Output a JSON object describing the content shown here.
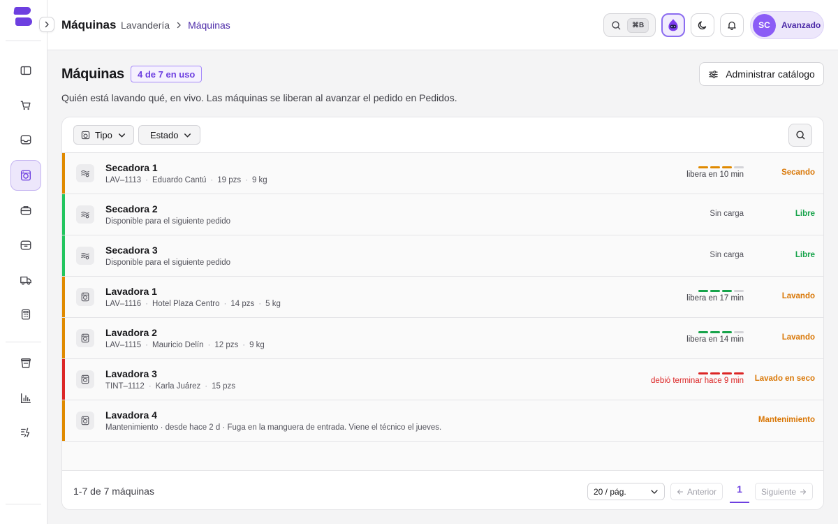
{
  "app": {
    "logo": "brand-logo"
  },
  "sidebar": {
    "items": [
      {
        "icon": "sidebar-layout-icon",
        "name": "sidebar-item-layout"
      },
      {
        "icon": "cart-icon",
        "name": "sidebar-item-cart"
      },
      {
        "icon": "inbox-icon",
        "name": "sidebar-item-inbox"
      },
      {
        "icon": "washing-machine-icon",
        "name": "sidebar-item-machines",
        "active": true
      },
      {
        "icon": "briefcase-icon",
        "name": "sidebar-item-briefcase"
      },
      {
        "icon": "archive-icon",
        "name": "sidebar-item-archive"
      },
      {
        "icon": "truck-icon",
        "name": "sidebar-item-delivery"
      },
      {
        "icon": "calculator-icon",
        "name": "sidebar-item-calculator"
      },
      {
        "icon": "bucket-icon",
        "name": "sidebar-item-supplies"
      },
      {
        "icon": "chart-icon",
        "name": "sidebar-item-reports"
      },
      {
        "icon": "sparkle-list-icon",
        "name": "sidebar-item-automation"
      }
    ]
  },
  "topbar": {
    "title": "Máquinas",
    "breadcrumb": [
      "Lavandería",
      "Máquinas"
    ],
    "search_shortcut": "⌘B",
    "user_initials": "SC",
    "user_level": "Avanzado"
  },
  "page": {
    "title": "Máquinas",
    "usage_badge": "4 de 7 en uso",
    "catalog_button": "Administrar catálogo",
    "subtitle": "Quién está lavando qué, en vivo. Las máquinas se liberan al avanzar el pedido en Pedidos."
  },
  "filters": {
    "type": "Tipo",
    "status": "Estado"
  },
  "colors": {
    "accent": "#6d3fe0",
    "orange": "#e08a00",
    "green": "#16a34a",
    "red": "#dc2626",
    "grey": "#d4d4d8"
  },
  "machines": [
    {
      "name": "Secadora 1",
      "kind": "dryer",
      "meta": [
        "LAV‒1113",
        "Eduardo Cantú",
        "19 pzs",
        "9 kg"
      ],
      "eta": "libera en 10 min",
      "progress": [
        1,
        1,
        1,
        0
      ],
      "progress_color": "#e08a00",
      "status": "Secando",
      "status_color": "#d97706",
      "stripe": "#e08a00"
    },
    {
      "name": "Secadora 2",
      "kind": "dryer",
      "meta": [
        "Disponible para el siguiente pedido"
      ],
      "eta": "Sin carga",
      "progress": [],
      "status": "Libre",
      "status_color": "#16a34a",
      "stripe": "#22c55e"
    },
    {
      "name": "Secadora 3",
      "kind": "dryer",
      "meta": [
        "Disponible para el siguiente pedido"
      ],
      "eta": "Sin carga",
      "progress": [],
      "status": "Libre",
      "status_color": "#16a34a",
      "stripe": "#22c55e"
    },
    {
      "name": "Lavadora 1",
      "kind": "washer",
      "meta": [
        "LAV‒1116",
        "Hotel Plaza Centro",
        "14 pzs",
        "5 kg"
      ],
      "eta": "libera en 17 min",
      "progress": [
        1,
        1,
        1,
        0
      ],
      "progress_color": "#16a34a",
      "status": "Lavando",
      "status_color": "#d97706",
      "stripe": "#e08a00"
    },
    {
      "name": "Lavadora 2",
      "kind": "washer",
      "meta": [
        "LAV‒1115",
        "Mauricio Delín",
        "12 pzs",
        "9 kg"
      ],
      "eta": "libera en 14 min",
      "progress": [
        1,
        1,
        1,
        0
      ],
      "progress_color": "#16a34a",
      "status": "Lavando",
      "status_color": "#d97706",
      "stripe": "#e08a00"
    },
    {
      "name": "Lavadora 3",
      "kind": "washer",
      "meta": [
        "TINT‒1112",
        "Karla Juárez",
        "15 pzs"
      ],
      "eta": "debió terminar hace 9 min",
      "late": true,
      "progress": [
        1,
        1,
        1,
        1
      ],
      "progress_color": "#dc2626",
      "status": "Lavado en seco",
      "status_color": "#d97706",
      "stripe": "#dc2626"
    },
    {
      "name": "Lavadora 4",
      "kind": "washer",
      "meta": [
        "Mantenimiento · desde hace 2 d · Fuga en la manguera de entrada. Viene el técnico el jueves."
      ],
      "eta": "",
      "progress": [],
      "status": "Mantenimiento",
      "status_color": "#d97706",
      "stripe": "#e08a00"
    }
  ],
  "footer": {
    "count": "1-7 de 7 máquinas",
    "per_page": "20 / pág.",
    "prev": "Anterior",
    "page": "1",
    "next": "Siguiente"
  }
}
